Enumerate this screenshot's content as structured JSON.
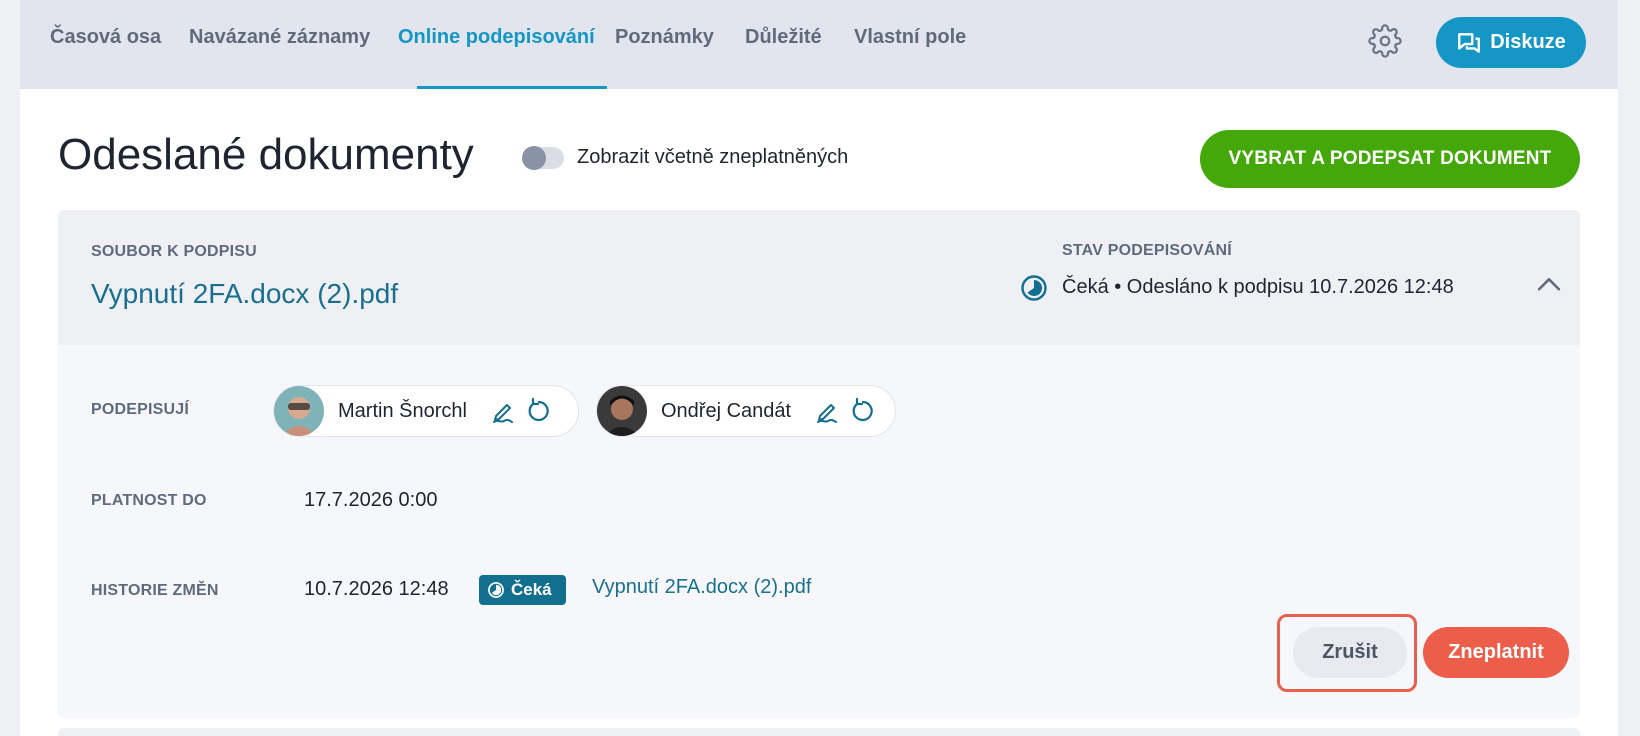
{
  "tabs": [
    {
      "label": "Časová osa"
    },
    {
      "label": "Navázané záznamy"
    },
    {
      "label": "Online podepisování"
    },
    {
      "label": "Poznámky"
    },
    {
      "label": "Důležité"
    },
    {
      "label": "Vlastní pole"
    }
  ],
  "active_tab": "Online podepisování",
  "header": {
    "discuss_label": "Diskuze"
  },
  "page": {
    "title": "Odeslané dokumenty",
    "toggle_label": "Zobrazit včetně zneplatněných",
    "primary_action": "VYBRAT A PODEPSAT DOKUMENT"
  },
  "document": {
    "file_label": "SOUBOR K PODPISU",
    "file_name": "Vypnutí 2FA.docx (2).pdf",
    "status_label": "STAV PODEPISOVÁNÍ",
    "status_text": "Čeká • Odesláno k podpisu 10.7.2026 12:48",
    "signers_label": "PODEPISUJÍ",
    "signers": [
      {
        "name": "Martin Šnorchl"
      },
      {
        "name": "Ondřej Candát"
      }
    ],
    "validity_label": "PLATNOST DO",
    "validity_value": "17.7.2026 0:00",
    "history_label": "HISTORIE ZMĚN",
    "history": {
      "timestamp": "10.7.2026 12:48",
      "badge": "Čeká",
      "file_name": "Vypnutí 2FA.docx (2).pdf"
    },
    "cancel_label": "Zrušit",
    "invalidate_label": "Zneplatnit"
  },
  "colors": {
    "accent": "#1497c4",
    "success": "#44a80a",
    "danger": "#ec5d4a",
    "link": "#1a6f8f"
  }
}
